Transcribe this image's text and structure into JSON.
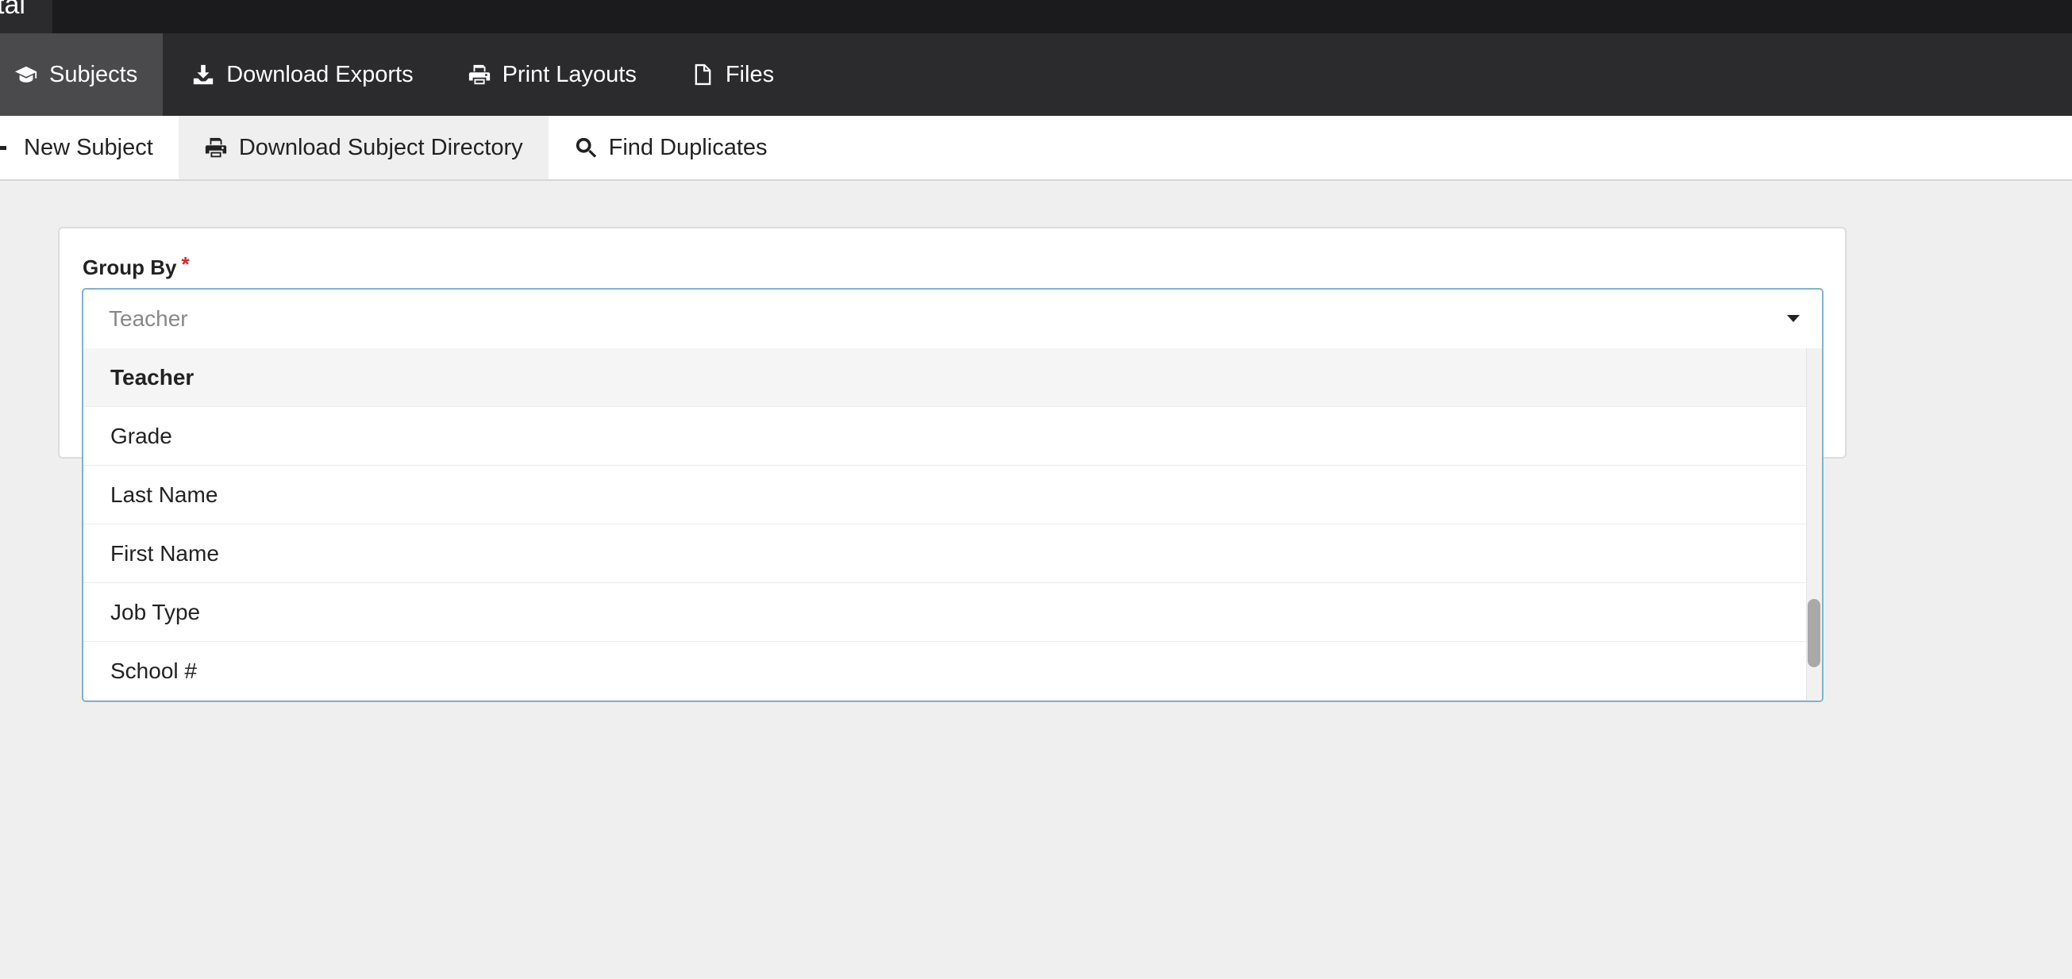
{
  "topbar": {
    "brand_fragment": "tal"
  },
  "mainnav": {
    "items": [
      {
        "label": "Subjects",
        "icon": "graduation-cap-icon",
        "active": true
      },
      {
        "label": "Download Exports",
        "icon": "download-icon"
      },
      {
        "label": "Print Layouts",
        "icon": "printer-icon"
      },
      {
        "label": "Files",
        "icon": "file-icon"
      }
    ]
  },
  "subnav": {
    "items": [
      {
        "label": "New Subject",
        "icon": "plus-icon"
      },
      {
        "label": "Download Subject Directory",
        "icon": "printer-icon",
        "active": true
      },
      {
        "label": "Find Duplicates",
        "icon": "search-icon"
      }
    ]
  },
  "form": {
    "group_by_label": "Group By",
    "required_mark": "*",
    "select_placeholder": "Teacher",
    "options": [
      "Teacher",
      "Grade",
      "Last Name",
      "First Name",
      "Job Type",
      "School #"
    ],
    "selected_index": 0
  },
  "colors": {
    "topbar": "#1b1b1d",
    "nav": "#2b2b2d",
    "nav_active": "#4a4a4c",
    "focus_border": "#7fb3cf",
    "required": "#d9262c"
  }
}
